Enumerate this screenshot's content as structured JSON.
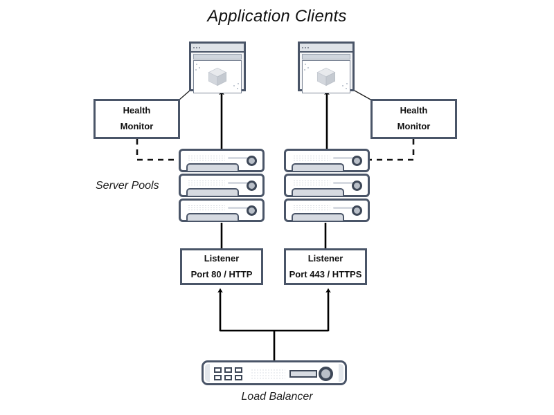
{
  "diagram": {
    "title": "Application Clients",
    "labels": {
      "server_pools": "Server Pools",
      "load_balancer": "Load Balancer"
    },
    "clients": [
      {
        "name": "client-left",
        "icon": "browser-window-cube-icon"
      },
      {
        "name": "client-right",
        "icon": "browser-window-cube-icon"
      }
    ],
    "health_monitors": [
      {
        "line1": "Health",
        "line2": "Monitor"
      },
      {
        "line1": "Health",
        "line2": "Monitor"
      }
    ],
    "listeners": [
      {
        "line1": "Listener",
        "line2": "Port 80 / HTTP"
      },
      {
        "line1": "Listener",
        "line2": "Port 443 / HTTPS"
      }
    ],
    "server_pools": [
      {
        "name": "pool-left",
        "server_count": 3
      },
      {
        "name": "pool-right",
        "server_count": 3
      }
    ],
    "load_balancer_device": {
      "port_count": 6,
      "icon": "network-appliance-icon"
    },
    "colors": {
      "outline": "#4a5568",
      "outline_dark": "#3d4757",
      "device_fill": "#ffffff",
      "accent_gray": "#d6dae1",
      "connector": "#000000",
      "text": "#111111"
    },
    "connectors": [
      {
        "from": "server-pool-left",
        "to": "client-left",
        "style": "solid-arrow"
      },
      {
        "from": "server-pool-right",
        "to": "client-right",
        "style": "solid-arrow"
      },
      {
        "from": "health-monitor-left",
        "to": "server-pool-left",
        "style": "dashed"
      },
      {
        "from": "health-monitor-right",
        "to": "server-pool-right",
        "style": "dashed"
      },
      {
        "from": "health-monitor-left",
        "to": "client-left",
        "style": "thin-line"
      },
      {
        "from": "health-monitor-right",
        "to": "client-right",
        "style": "thin-line"
      },
      {
        "from": "listener-http",
        "to": "server-pool-left",
        "style": "solid"
      },
      {
        "from": "listener-https",
        "to": "server-pool-right",
        "style": "solid"
      },
      {
        "from": "load-balancer",
        "to": "listener-http",
        "style": "solid-arrow"
      },
      {
        "from": "load-balancer",
        "to": "listener-https",
        "style": "solid-arrow"
      }
    ]
  }
}
